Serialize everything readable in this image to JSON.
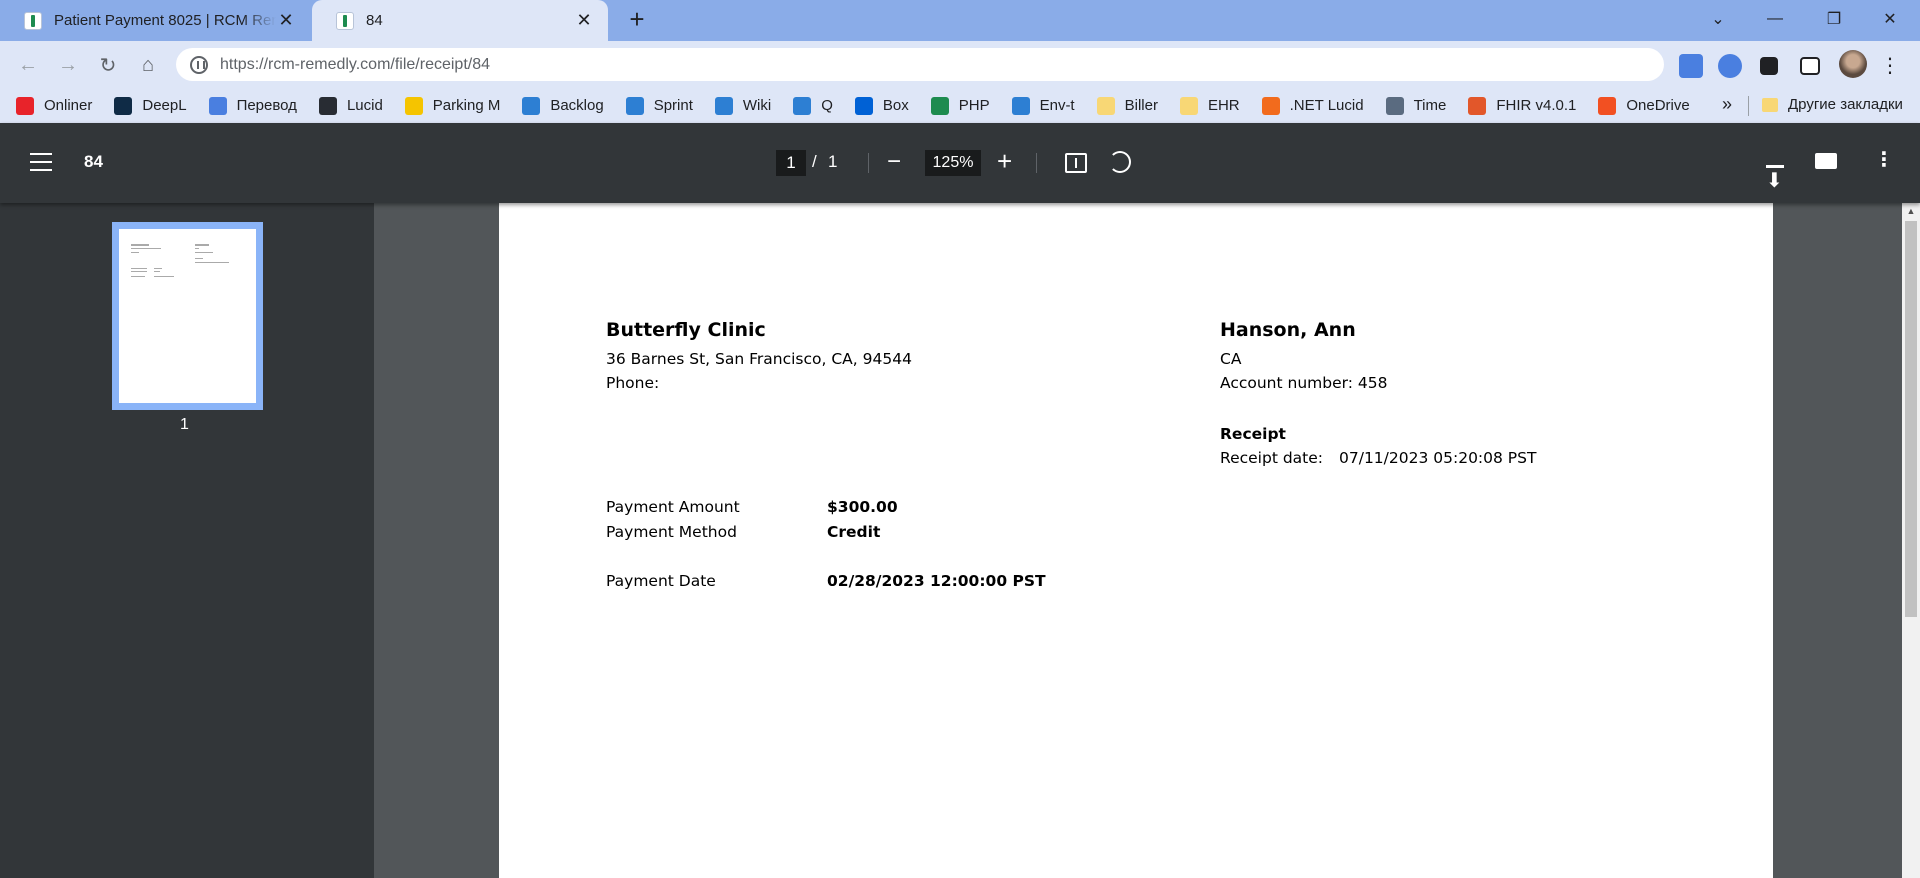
{
  "browser": {
    "tabs": [
      {
        "title": "Patient Payment 8025 | RCM Remedly",
        "active": false
      },
      {
        "title": "84",
        "active": true
      }
    ],
    "url": "https://rcm-remedly.com/file/receipt/84",
    "bookmarks": [
      {
        "label": "Onliner",
        "color": "#e8232a"
      },
      {
        "label": "DeepL",
        "color": "#0f2b46"
      },
      {
        "label": "Перевод",
        "color": "#4a7fe0"
      },
      {
        "label": "Lucid",
        "color": "#282c33"
      },
      {
        "label": "Parking M",
        "color": "#f5c400"
      },
      {
        "label": "Backlog",
        "color": "#2d7fd3"
      },
      {
        "label": "Sprint",
        "color": "#2d7fd3"
      },
      {
        "label": "Wiki",
        "color": "#2d7fd3"
      },
      {
        "label": "Q",
        "color": "#2d7fd3"
      },
      {
        "label": "Box",
        "color": "#0061d5"
      },
      {
        "label": "PHP",
        "color": "#1d8b4f"
      },
      {
        "label": "Env-t",
        "color": "#2d7fd3"
      },
      {
        "label": "Biller",
        "color": "#f8d775"
      },
      {
        "label": "EHR",
        "color": "#f8d775"
      },
      {
        "label": ".NET Lucid",
        "color": "#f26b1d"
      },
      {
        "label": "Time",
        "color": "#5a6b80"
      },
      {
        "label": "FHIR v4.0.1",
        "color": "#e2572a"
      },
      {
        "label": "OneDrive",
        "color": "#f25022"
      }
    ],
    "other_bookmarks": "Другие закладки"
  },
  "pdf_viewer": {
    "title": "84",
    "current_page": "1",
    "page_separator": "/",
    "total_pages": "1",
    "zoom": "125%",
    "thumbnail_label": "1"
  },
  "receipt": {
    "clinic_name": "Butterfly Clinic",
    "clinic_address": "36 Barnes St, San Francisco, CA, 94544",
    "clinic_phone_label": "Phone:",
    "patient_name": "Hanson, Ann",
    "patient_state": "CA",
    "account_number": "Account number: 458",
    "receipt_heading": "Receipt",
    "receipt_date_label": "Receipt date:",
    "receipt_date_value": "07/11/2023 05:20:08 PST",
    "payment_amount_label": "Payment Amount",
    "payment_amount_value": "$300.00",
    "payment_method_label": "Payment Method",
    "payment_method_value": "Credit",
    "payment_date_label": "Payment Date",
    "payment_date_value": "02/28/2023 12:00:00 PST"
  }
}
